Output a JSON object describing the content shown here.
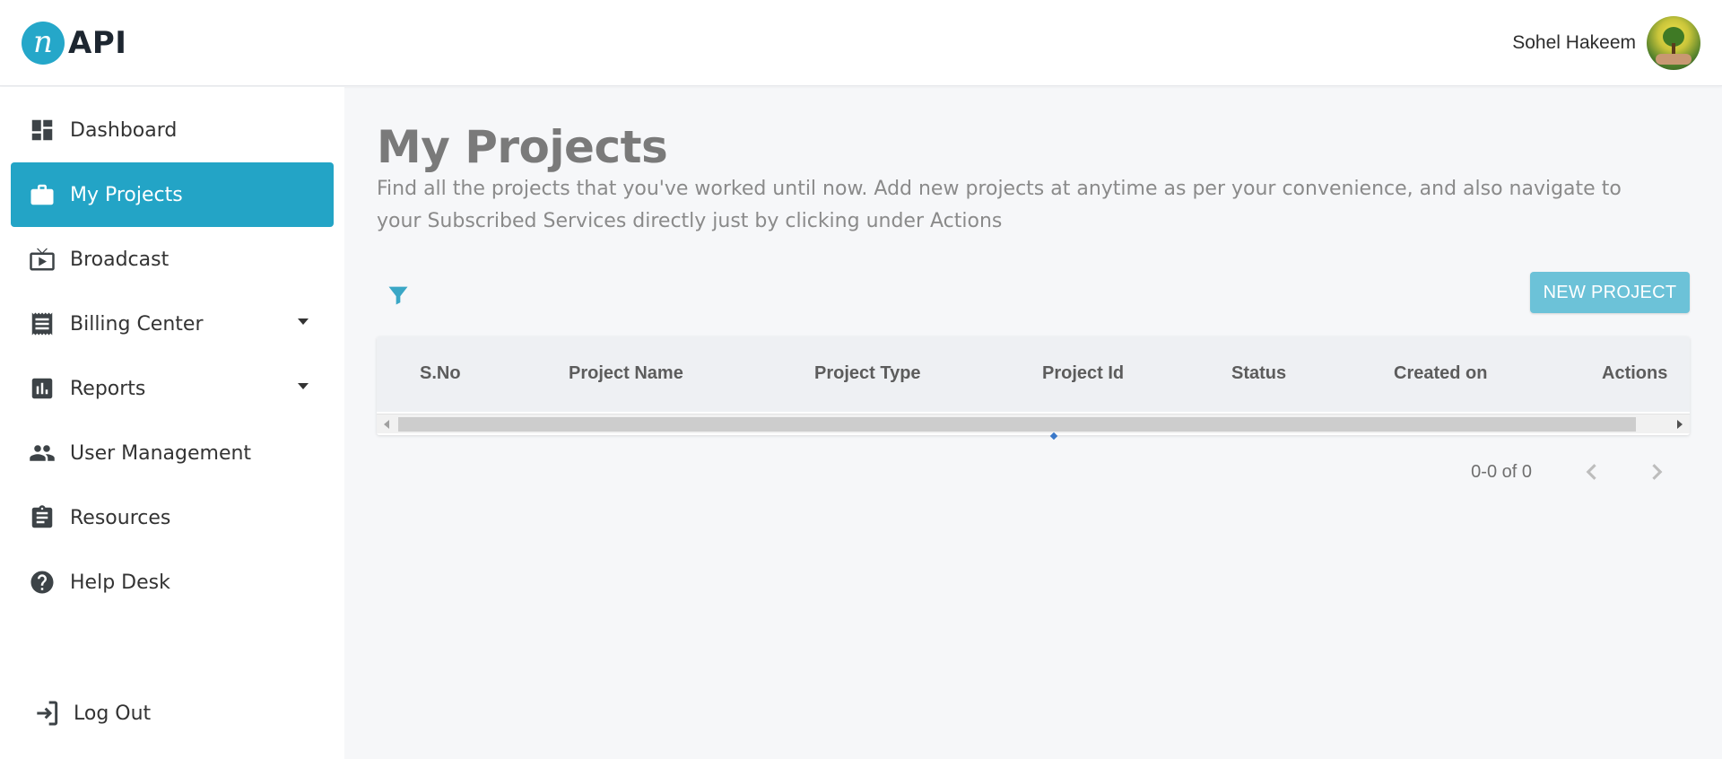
{
  "header": {
    "logo_mark": "n",
    "logo_text": "API",
    "user_name": "Sohel Hakeem"
  },
  "sidebar": {
    "items": [
      {
        "label": "Dashboard",
        "icon": "dashboard-icon",
        "active": false,
        "has_dropdown": false
      },
      {
        "label": "My Projects",
        "icon": "briefcase-icon",
        "active": true,
        "has_dropdown": false
      },
      {
        "label": "Broadcast",
        "icon": "tv-icon",
        "active": false,
        "has_dropdown": false
      },
      {
        "label": "Billing Center",
        "icon": "receipt-icon",
        "active": false,
        "has_dropdown": true
      },
      {
        "label": "Reports",
        "icon": "bar-chart-icon",
        "active": false,
        "has_dropdown": true
      },
      {
        "label": "User Management",
        "icon": "users-icon",
        "active": false,
        "has_dropdown": false
      },
      {
        "label": "Resources",
        "icon": "clipboard-icon",
        "active": false,
        "has_dropdown": false
      },
      {
        "label": "Help Desk",
        "icon": "help-icon",
        "active": false,
        "has_dropdown": false
      }
    ],
    "logout_label": "Log Out"
  },
  "main": {
    "title": "My Projects",
    "description": "Find all the projects that you've worked until now. Add new projects at anytime as per your convenience, and also navigate to your Subscribed Services directly just by clicking under Actions",
    "new_project_label": "NEW PROJECT",
    "table": {
      "columns": [
        "S.No",
        "Project Name",
        "Project Type",
        "Project Id",
        "Status",
        "Created on",
        "Actions"
      ],
      "rows": []
    },
    "pagination": {
      "range_text": "0-0 of 0"
    }
  },
  "colors": {
    "accent": "#23a4c6",
    "button": "#6cc2d8",
    "filter_icon": "#3aa7c6"
  }
}
